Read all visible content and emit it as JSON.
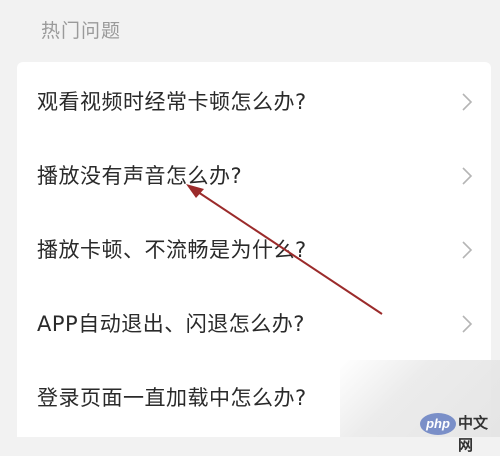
{
  "section": {
    "title": "热门问题"
  },
  "faq": {
    "items": [
      {
        "label": "观看视频时经常卡顿怎么办?",
        "has_chevron": true
      },
      {
        "label": "播放没有声音怎么办?",
        "has_chevron": true
      },
      {
        "label": "播放卡顿、不流畅是为什么?",
        "has_chevron": true
      },
      {
        "label": "APP自动退出、闪退怎么办?",
        "has_chevron": true
      },
      {
        "label": "登录页面一直加载中怎么办?",
        "has_chevron": false
      }
    ]
  },
  "annotation": {
    "arrow_color": "#9b2b2b"
  },
  "watermark": {
    "logo_text": "php",
    "site_text": "中文网"
  },
  "colors": {
    "background": "#f2f2f2",
    "card": "#ffffff",
    "text": "#2a2a2a",
    "muted": "#9a9a9a",
    "chevron": "#b5b5b5"
  },
  "icons": {
    "row_chevron": "chevron-right-icon"
  }
}
